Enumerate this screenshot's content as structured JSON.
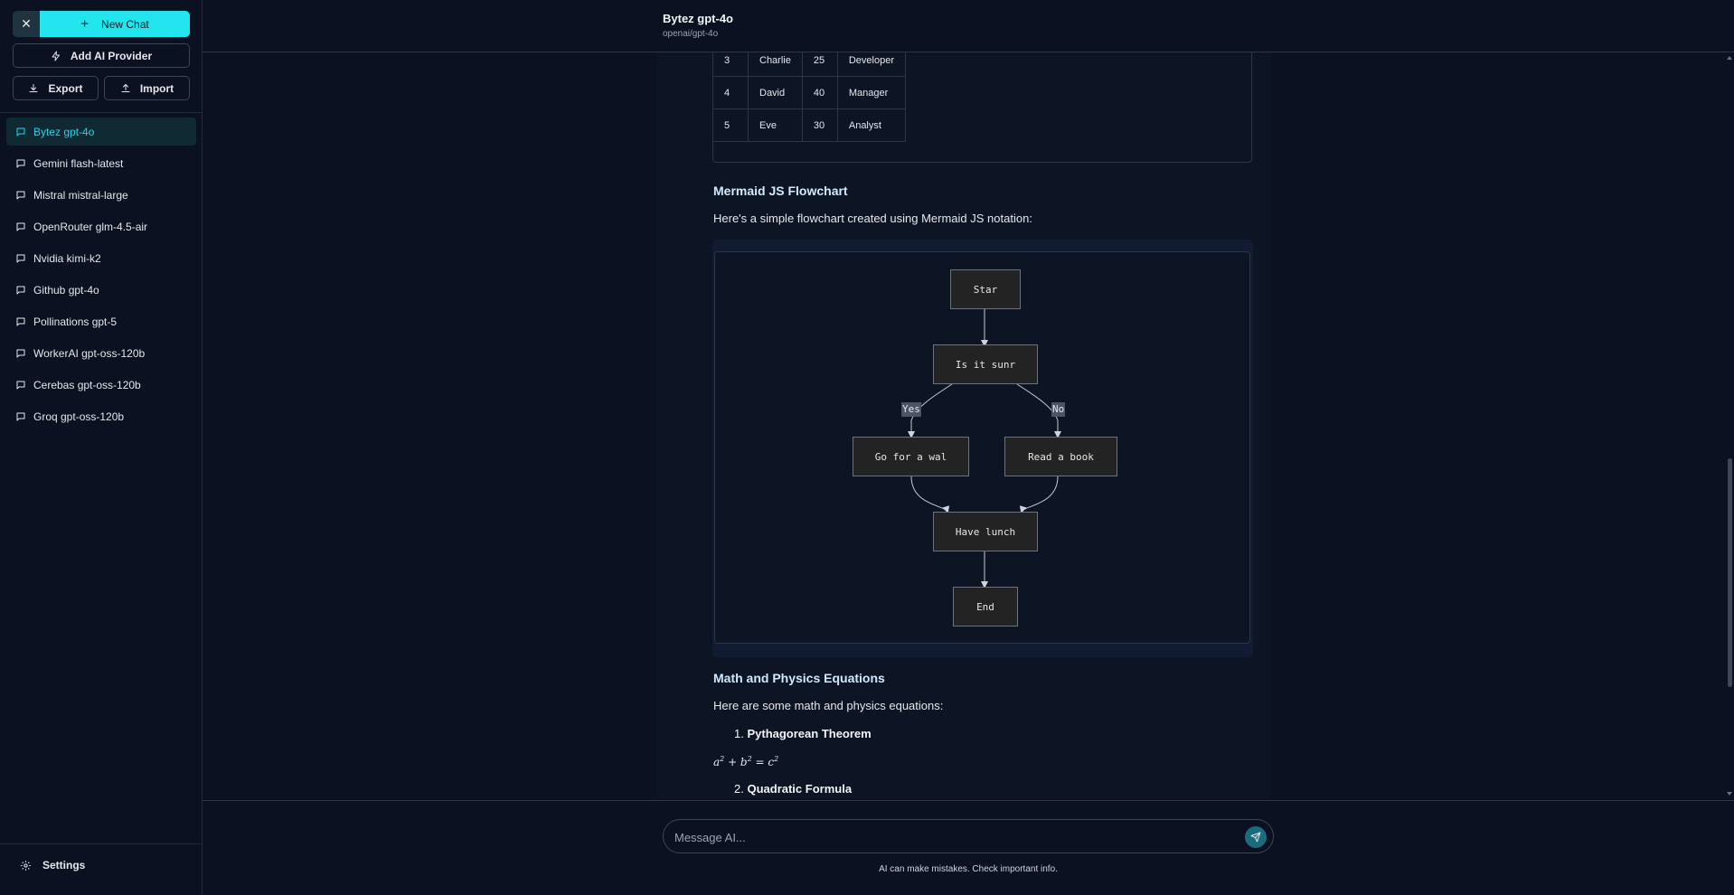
{
  "sidebar": {
    "new_chat_label": "New Chat",
    "add_provider_label": "Add AI Provider",
    "export_label": "Export",
    "import_label": "Import",
    "chats": [
      {
        "label": "Bytez gpt-4o",
        "active": true
      },
      {
        "label": "Gemini flash-latest"
      },
      {
        "label": "Mistral mistral-large"
      },
      {
        "label": "OpenRouter glm-4.5-air"
      },
      {
        "label": "Nvidia kimi-k2"
      },
      {
        "label": "Github gpt-4o"
      },
      {
        "label": "Pollinations gpt-5"
      },
      {
        "label": "WorkerAI gpt-oss-120b"
      },
      {
        "label": "Cerebas gpt-oss-120b"
      },
      {
        "label": "Groq gpt-oss-120b"
      }
    ],
    "settings_label": "Settings"
  },
  "header": {
    "title": "Bytez gpt-4o",
    "subtitle": "openai/gpt-4o"
  },
  "message": {
    "table_rows": [
      [
        "3",
        "Charlie",
        "25",
        "Developer"
      ],
      [
        "4",
        "David",
        "40",
        "Manager"
      ],
      [
        "5",
        "Eve",
        "30",
        "Analyst"
      ]
    ],
    "mermaid_heading": "Mermaid JS Flowchart",
    "mermaid_intro": "Here's a simple flowchart created using Mermaid JS notation:",
    "flowchart": {
      "nodes": {
        "start": "Star",
        "question": "Is it sunr",
        "walk": "Go for a wal",
        "book": "Read a book",
        "lunch": "Have lunch",
        "end": "End"
      },
      "edge_yes": "Yes",
      "edge_no": "No"
    },
    "math_heading": "Math and Physics Equations",
    "math_intro": "Here are some math and physics equations:",
    "item1_num": "1.",
    "item1_title": "Pythagorean Theorem",
    "item2_num": "2.",
    "item2_title": "Quadratic Formula"
  },
  "composer": {
    "placeholder": "Message AI...",
    "disclaimer": "AI can make mistakes. Check important info."
  },
  "colors": {
    "accent": "#22e5ee",
    "background": "#0b1120",
    "active_item": "#22d3ee"
  }
}
